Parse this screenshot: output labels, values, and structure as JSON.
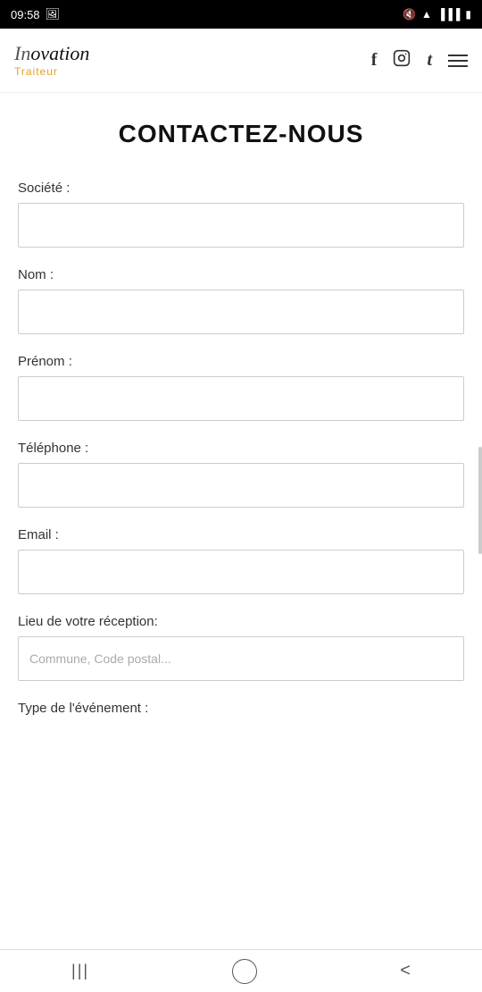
{
  "status_bar": {
    "time": "09:58",
    "icons": [
      "image",
      "mute",
      "wifi",
      "signal",
      "battery"
    ]
  },
  "navbar": {
    "logo_text": "Inovation",
    "logo_sub": "Traiteur",
    "icons": {
      "facebook": "f",
      "instagram": "📷",
      "twitter": "t",
      "menu": "☰"
    }
  },
  "page": {
    "title": "CONTACTEZ-NOUS"
  },
  "form": {
    "fields": [
      {
        "id": "societe",
        "label": "Société :",
        "type": "text",
        "placeholder": ""
      },
      {
        "id": "nom",
        "label": "Nom :",
        "type": "text",
        "placeholder": ""
      },
      {
        "id": "prenom",
        "label": "Prénom :",
        "type": "text",
        "placeholder": ""
      },
      {
        "id": "telephone",
        "label": "Téléphone :",
        "type": "tel",
        "placeholder": ""
      },
      {
        "id": "email",
        "label": "Email :",
        "type": "email",
        "placeholder": ""
      },
      {
        "id": "lieu",
        "label": "Lieu de votre réception:",
        "type": "text",
        "placeholder": "Commune, Code postal..."
      },
      {
        "id": "type_evenement",
        "label": "Type de l'événement :",
        "type": "text",
        "placeholder": ""
      }
    ]
  },
  "bottom_nav": {
    "items": [
      "|||",
      "○",
      "<"
    ]
  }
}
